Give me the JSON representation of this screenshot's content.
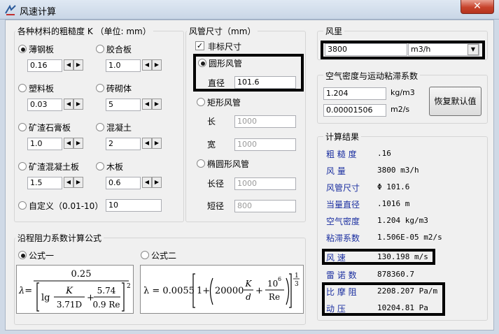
{
  "window": {
    "title": "风速计算",
    "close": "✕"
  },
  "materials": {
    "group_label": "各种材料的粗糙度 K  （单位: mm）",
    "items": [
      {
        "label": "薄钢板",
        "value": "0.16",
        "selected": true
      },
      {
        "label": "胶合板",
        "value": "1.0",
        "selected": false
      },
      {
        "label": "塑料板",
        "value": "0.03",
        "selected": false
      },
      {
        "label": "砖砌体",
        "value": "5",
        "selected": false
      },
      {
        "label": "矿渣石膏板",
        "value": "1.0",
        "selected": false
      },
      {
        "label": "混凝土",
        "value": "2",
        "selected": false
      },
      {
        "label": "矿渣混凝土板",
        "value": "1.5",
        "selected": false
      },
      {
        "label": "木板",
        "value": "0.6",
        "selected": false
      }
    ],
    "custom_label": "自定义（0.01-10）",
    "custom_value": "10",
    "spin_left": "◀",
    "spin_right": "▶"
  },
  "duct": {
    "group_label": "风管尺寸（mm）",
    "nonstandard_label": "非标尺寸",
    "nonstandard_check": "✓",
    "round_label": "圆形风管",
    "diameter_label": "直径",
    "diameter_value": "101.6",
    "rect_label": "矩形风管",
    "length_label": "长",
    "length_value": "1000",
    "width_label": "宽",
    "width_value": "1000",
    "ellipse_label": "椭圆形风管",
    "major_label": "长径",
    "major_value": "1000",
    "minor_label": "短径",
    "minor_value": "800"
  },
  "airflow": {
    "group_label": "风里",
    "value": "3800",
    "unit": "m3/h",
    "dropdown_arrow": "▼"
  },
  "air_props": {
    "group_label": "空气密度与运动粘滞系数",
    "density_value": "1.204",
    "density_unit": "kg/m3",
    "viscosity_value": "0.00001506",
    "viscosity_unit": "m2/s",
    "reset_label": "恢复默认值"
  },
  "results": {
    "group_label": "计算结果",
    "rows": [
      {
        "label": "粗 糙 度",
        "value": ".16"
      },
      {
        "label": "风    量",
        "value": "3800 m3/h"
      },
      {
        "label": "风管尺寸",
        "value": "Φ 101.6"
      },
      {
        "label": "当量直径",
        "value": ".1016 m"
      },
      {
        "label": "空气密度",
        "value": "1.204 kg/m3"
      },
      {
        "label": "粘滞系数",
        "value": "1.506E-05 m2/s"
      },
      {
        "label": "风    速",
        "value": "130.198 m/s"
      },
      {
        "label": "雷 诺 数",
        "value": "878360.7"
      },
      {
        "label": "比 摩 阻",
        "value": "2208.207 Pa/m"
      },
      {
        "label": "动    压",
        "value": "10204.81 Pa"
      }
    ]
  },
  "formula_group": {
    "group_label": "沿程阻力系数计算公式",
    "formula1_label": "公式一",
    "formula2_label": "公式二",
    "f1": {
      "lambda": "λ=",
      "numerator": "0.25",
      "lg": "lg",
      "K": "K",
      "d371D": "3.71D",
      "plus": "+",
      "n574": "5.74",
      "d09Re": "0.9 Re",
      "sq": "2"
    },
    "f2": {
      "lhs": "λ = 0.0055",
      "one_plus": "1+",
      "c20000": "20000",
      "K": "K",
      "d": "d",
      "plus": "+",
      "n106": "10",
      "exp6": "6",
      "Re": "Re",
      "exp_num": "1",
      "exp_den": "3"
    }
  }
}
